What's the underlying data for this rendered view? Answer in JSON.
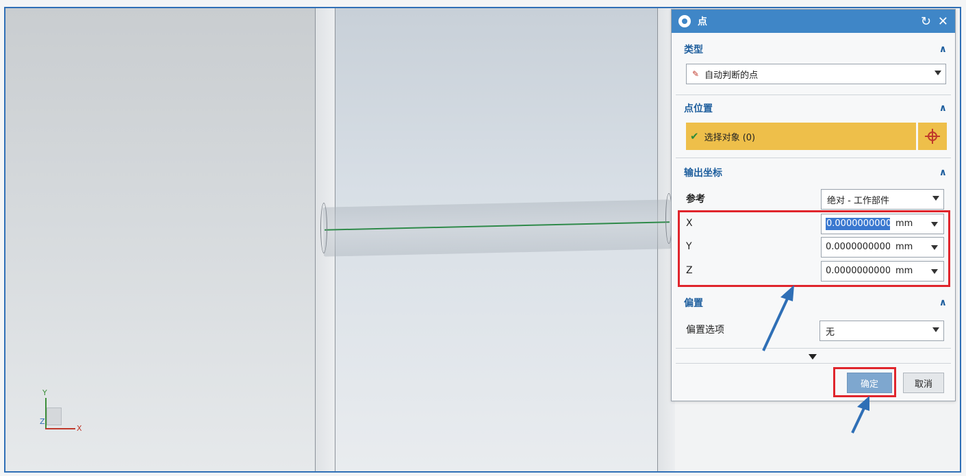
{
  "dialog": {
    "title": "点",
    "sections": {
      "type": {
        "label": "类型",
        "dropdown_value": "自动判断的点"
      },
      "point_location": {
        "label": "点位置",
        "select_object": "选择对象 (0)"
      },
      "output_coords": {
        "label": "输出坐标",
        "reference_label": "参考",
        "reference_value": "绝对 - 工作部件",
        "x": {
          "label": "X",
          "value": "0.0000000000",
          "unit": "mm"
        },
        "y": {
          "label": "Y",
          "value": "0.0000000000",
          "unit": "mm"
        },
        "z": {
          "label": "Z",
          "value": "0.0000000000",
          "unit": "mm"
        }
      },
      "offset": {
        "label": "偏置",
        "option_label": "偏置选项",
        "option_value": "无"
      }
    },
    "buttons": {
      "ok": "确定",
      "cancel": "取消"
    }
  },
  "triad": {
    "x": "X",
    "y": "Y",
    "z": "Z"
  },
  "colors": {
    "title_bar": "#3f86c7",
    "highlight": "#eebf4a",
    "annotation_red": "#e0252c",
    "annotation_blue": "#2f6fb6"
  }
}
